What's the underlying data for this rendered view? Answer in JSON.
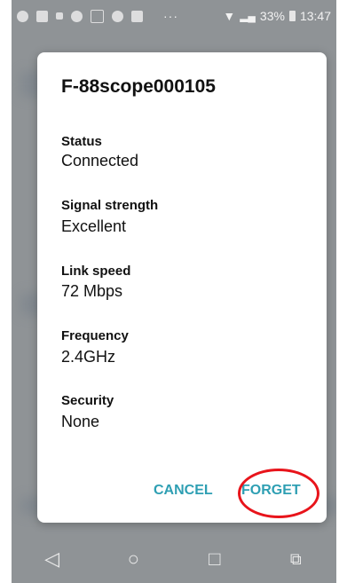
{
  "status_bar": {
    "left_icons": [
      "whatsapp-icon",
      "message-icon",
      "square-icon",
      "group-icon",
      "hashtag-icon",
      "camera-icon",
      "shirt-icon"
    ],
    "dots": "···",
    "battery_percent": "33%",
    "time": "13:47"
  },
  "dialog": {
    "title": "F-88scope000105",
    "fields": [
      {
        "label": "Status",
        "value": "Connected"
      },
      {
        "label": "Signal strength",
        "value": "Excellent"
      },
      {
        "label": "Link speed",
        "value": "72 Mbps"
      },
      {
        "label": "Frequency",
        "value": "2.4GHz"
      },
      {
        "label": "Security",
        "value": "None"
      }
    ],
    "cancel_label": "CANCEL",
    "forget_label": "FORGET"
  },
  "nav": {
    "back": "◁",
    "home": "○",
    "recents": "□",
    "switch": "⧉"
  },
  "colors": {
    "accent": "#2e9fb3",
    "highlight": "#e8141b",
    "overlay": "#8f9396"
  }
}
